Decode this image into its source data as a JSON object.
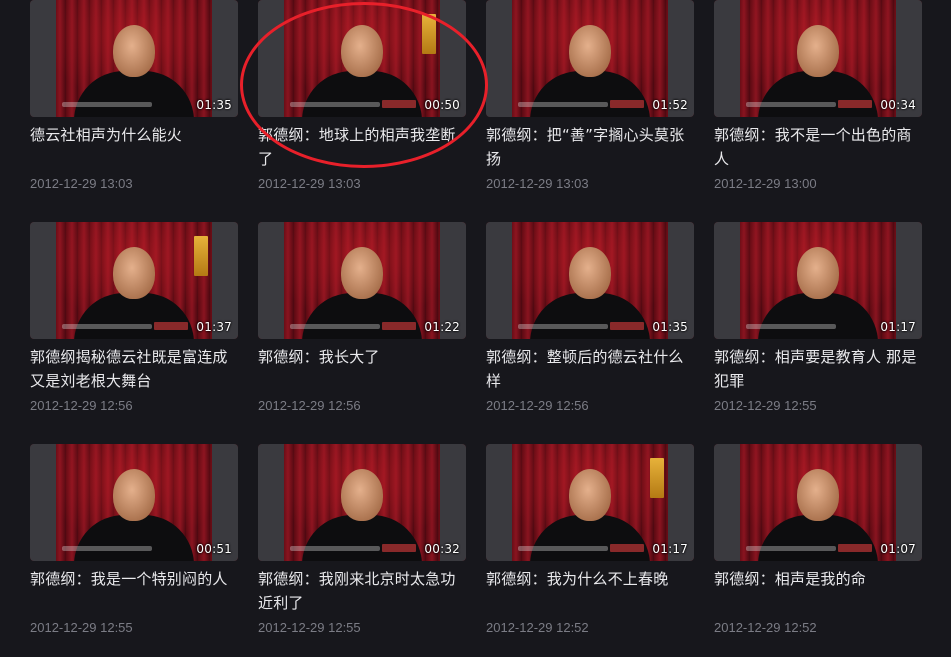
{
  "videos": [
    {
      "title": "德云社相声为什么能火",
      "duration": "01:35",
      "date": "2012-12-29 13:03"
    },
    {
      "title": "郭德纲：地球上的相声我垄断了",
      "duration": "00:50",
      "date": "2012-12-29 13:03"
    },
    {
      "title": "郭德纲：把“善”字搁心头莫张扬",
      "duration": "01:52",
      "date": "2012-12-29 13:03"
    },
    {
      "title": "郭德纲：我不是一个出色的商人",
      "duration": "00:34",
      "date": "2012-12-29 13:00"
    },
    {
      "title": "郭德纲揭秘德云社既是富连成又是刘老根大舞台",
      "duration": "01:37",
      "date": "2012-12-29 12:56"
    },
    {
      "title": "郭德纲：我长大了",
      "duration": "01:22",
      "date": "2012-12-29 12:56"
    },
    {
      "title": "郭德纲：整顿后的德云社什么样",
      "duration": "01:35",
      "date": "2012-12-29 12:56"
    },
    {
      "title": "郭德纲：相声要是教育人 那是犯罪",
      "duration": "01:17",
      "date": "2012-12-29 12:55"
    },
    {
      "title": "郭德纲：我是一个特别闷的人",
      "duration": "00:51",
      "date": "2012-12-29 12:55"
    },
    {
      "title": "郭德纲：我刚来北京时太急功近利了",
      "duration": "00:32",
      "date": "2012-12-29 12:55"
    },
    {
      "title": "郭德纲：我为什么不上春晚",
      "duration": "01:17",
      "date": "2012-12-29 12:52"
    },
    {
      "title": "郭德纲：相声是我的命",
      "duration": "01:07",
      "date": "2012-12-29 12:52"
    }
  ],
  "annotation": {
    "color": "#e8202a",
    "shape": "ellipse",
    "target": "video-card-2"
  },
  "colors": {
    "background": "#17171c",
    "title_text": "#e9e9ec",
    "date_text": "#7b7c85"
  }
}
